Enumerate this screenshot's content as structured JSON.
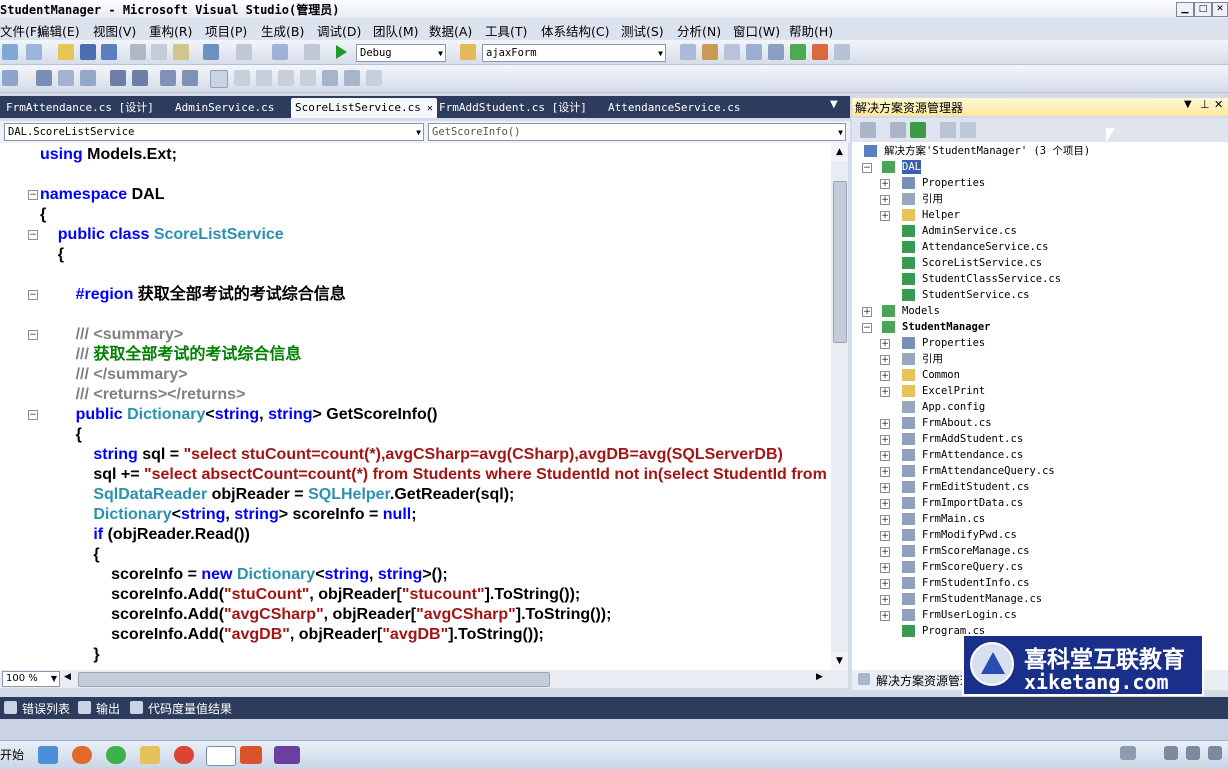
{
  "window": {
    "title": "StudentManager - Microsoft Visual Studio(管理员)"
  },
  "menu": [
    "文件(F)",
    "编辑(E)",
    "视图(V)",
    "重构(R)",
    "项目(P)",
    "生成(B)",
    "调试(D)",
    "团队(M)",
    "数据(A)",
    "工具(T)",
    "体系结构(C)",
    "测试(S)",
    "分析(N)",
    "窗口(W)",
    "帮助(H)"
  ],
  "toolbar": {
    "config": "Debug",
    "target": "ajaxForm"
  },
  "tabs": [
    {
      "label": "FrmAttendance.cs [设计]",
      "active": false
    },
    {
      "label": "AdminService.cs",
      "active": false
    },
    {
      "label": "ScoreListService.cs",
      "active": true
    },
    {
      "label": "FrmAddStudent.cs [设计]",
      "active": false
    },
    {
      "label": "AttendanceService.cs",
      "active": false
    }
  ],
  "navbar": {
    "type_combo": "DAL.ScoreListService",
    "member_combo": "GetScoreInfo()"
  },
  "code": [
    [
      {
        "t": "using ",
        "c": "kw"
      },
      {
        "t": "Models.Ext;",
        "c": ""
      }
    ],
    [],
    [
      {
        "t": "namespace ",
        "c": "kw"
      },
      {
        "t": "DAL",
        "c": ""
      }
    ],
    [
      {
        "t": "{",
        "c": ""
      }
    ],
    [
      {
        "t": "    public class ",
        "c": "kw"
      },
      {
        "t": "ScoreListService",
        "c": "ty"
      }
    ],
    [
      {
        "t": "    {",
        "c": ""
      }
    ],
    [],
    [
      {
        "t": "        #region ",
        "c": "kw"
      },
      {
        "t": "获取全部考试的考试综合信息",
        "c": ""
      }
    ],
    [],
    [
      {
        "t": "        /// ",
        "c": "gy"
      },
      {
        "t": "<summary>",
        "c": "gy"
      }
    ],
    [
      {
        "t": "        /// ",
        "c": "gy"
      },
      {
        "t": "获取全部考试的考试综合信息",
        "c": "cm"
      }
    ],
    [
      {
        "t": "        /// ",
        "c": "gy"
      },
      {
        "t": "</summary>",
        "c": "gy"
      }
    ],
    [
      {
        "t": "        /// ",
        "c": "gy"
      },
      {
        "t": "<returns></returns>",
        "c": "gy"
      }
    ],
    [
      {
        "t": "        public ",
        "c": "kw"
      },
      {
        "t": "Dictionary",
        "c": "ty"
      },
      {
        "t": "<",
        "c": ""
      },
      {
        "t": "string",
        "c": "kw"
      },
      {
        "t": ", ",
        "c": ""
      },
      {
        "t": "string",
        "c": "kw"
      },
      {
        "t": "> GetScoreInfo()",
        "c": ""
      }
    ],
    [
      {
        "t": "        {",
        "c": ""
      }
    ],
    [
      {
        "t": "            string ",
        "c": "kw"
      },
      {
        "t": "sql = ",
        "c": ""
      },
      {
        "t": "\"select stuCount=count(*),avgCSharp=avg(CSharp),avgDB=avg(SQLServerDB)",
        "c": "st"
      }
    ],
    [
      {
        "t": "            sql += ",
        "c": ""
      },
      {
        "t": "\"select absectCount=count(*) from Students where StudentId not in(select StudentId from ScoreList)\"",
        "c": "st"
      }
    ],
    [
      {
        "t": "            SqlDataReader ",
        "c": "ty"
      },
      {
        "t": "objReader = ",
        "c": ""
      },
      {
        "t": "SQLHelper",
        "c": "ty"
      },
      {
        "t": ".GetReader(sql);",
        "c": ""
      }
    ],
    [
      {
        "t": "            Dictionary",
        "c": "ty"
      },
      {
        "t": "<",
        "c": ""
      },
      {
        "t": "string",
        "c": "kw"
      },
      {
        "t": ", ",
        "c": ""
      },
      {
        "t": "string",
        "c": "kw"
      },
      {
        "t": "> scoreInfo = ",
        "c": ""
      },
      {
        "t": "null",
        "c": "kw"
      },
      {
        "t": ";",
        "c": ""
      }
    ],
    [
      {
        "t": "            if ",
        "c": "kw"
      },
      {
        "t": "(objReader.Read())",
        "c": ""
      }
    ],
    [
      {
        "t": "            {",
        "c": ""
      }
    ],
    [
      {
        "t": "                scoreInfo = ",
        "c": ""
      },
      {
        "t": "new ",
        "c": "kw"
      },
      {
        "t": "Dictionary",
        "c": "ty"
      },
      {
        "t": "<",
        "c": ""
      },
      {
        "t": "string",
        "c": "kw"
      },
      {
        "t": ", ",
        "c": ""
      },
      {
        "t": "string",
        "c": "kw"
      },
      {
        "t": ">();",
        "c": ""
      }
    ],
    [
      {
        "t": "                scoreInfo.Add(",
        "c": ""
      },
      {
        "t": "\"stuCount\"",
        "c": "st"
      },
      {
        "t": ", objReader[",
        "c": ""
      },
      {
        "t": "\"stucount\"",
        "c": "st"
      },
      {
        "t": "].ToString());",
        "c": ""
      }
    ],
    [
      {
        "t": "                scoreInfo.Add(",
        "c": ""
      },
      {
        "t": "\"avgCSharp\"",
        "c": "st"
      },
      {
        "t": ", objReader[",
        "c": ""
      },
      {
        "t": "\"avgCSharp\"",
        "c": "st"
      },
      {
        "t": "].ToString());",
        "c": ""
      }
    ],
    [
      {
        "t": "                scoreInfo.Add(",
        "c": ""
      },
      {
        "t": "\"avgDB\"",
        "c": "st"
      },
      {
        "t": ", objReader[",
        "c": ""
      },
      {
        "t": "\"avgDB\"",
        "c": "st"
      },
      {
        "t": "].ToString());",
        "c": ""
      }
    ],
    [
      {
        "t": "            }",
        "c": ""
      }
    ]
  ],
  "zoom": "100 %",
  "solution_explorer": {
    "title": "解决方案资源管理器",
    "tab_label": "解决方案资源管理器",
    "nodes": [
      {
        "label": "解决方案'StudentManager' (3 个项目)",
        "level": 0,
        "exp": "",
        "icon": "solution"
      },
      {
        "label": "DAL",
        "level": 1,
        "exp": "−",
        "icon": "project",
        "selected": true
      },
      {
        "label": "Properties",
        "level": 2,
        "exp": "+",
        "icon": "properties"
      },
      {
        "label": "引用",
        "level": 2,
        "exp": "+",
        "icon": "references"
      },
      {
        "label": "Helper",
        "level": 2,
        "exp": "+",
        "icon": "folder"
      },
      {
        "label": "AdminService.cs",
        "level": 2,
        "exp": "",
        "icon": "cs"
      },
      {
        "label": "AttendanceService.cs",
        "level": 2,
        "exp": "",
        "icon": "cs"
      },
      {
        "label": "ScoreListService.cs",
        "level": 2,
        "exp": "",
        "icon": "cs"
      },
      {
        "label": "StudentClassService.cs",
        "level": 2,
        "exp": "",
        "icon": "cs"
      },
      {
        "label": "StudentService.cs",
        "level": 2,
        "exp": "",
        "icon": "cs"
      },
      {
        "label": "Models",
        "level": 1,
        "exp": "+",
        "icon": "project"
      },
      {
        "label": "StudentManager",
        "level": 1,
        "exp": "−",
        "icon": "project",
        "bold": true
      },
      {
        "label": "Properties",
        "level": 2,
        "exp": "+",
        "icon": "properties"
      },
      {
        "label": "引用",
        "level": 2,
        "exp": "+",
        "icon": "references"
      },
      {
        "label": "Common",
        "level": 2,
        "exp": "+",
        "icon": "folder"
      },
      {
        "label": "ExcelPrint",
        "level": 2,
        "exp": "+",
        "icon": "folder"
      },
      {
        "label": "App.config",
        "level": 2,
        "exp": "",
        "icon": "config"
      },
      {
        "label": "FrmAbout.cs",
        "level": 2,
        "exp": "+",
        "icon": "form"
      },
      {
        "label": "FrmAddStudent.cs",
        "level": 2,
        "exp": "+",
        "icon": "form"
      },
      {
        "label": "FrmAttendance.cs",
        "level": 2,
        "exp": "+",
        "icon": "form"
      },
      {
        "label": "FrmAttendanceQuery.cs",
        "level": 2,
        "exp": "+",
        "icon": "form"
      },
      {
        "label": "FrmEditStudent.cs",
        "level": 2,
        "exp": "+",
        "icon": "form"
      },
      {
        "label": "FrmImportData.cs",
        "level": 2,
        "exp": "+",
        "icon": "form"
      },
      {
        "label": "FrmMain.cs",
        "level": 2,
        "exp": "+",
        "icon": "form"
      },
      {
        "label": "FrmModifyPwd.cs",
        "level": 2,
        "exp": "+",
        "icon": "form"
      },
      {
        "label": "FrmScoreManage.cs",
        "level": 2,
        "exp": "+",
        "icon": "form"
      },
      {
        "label": "FrmScoreQuery.cs",
        "level": 2,
        "exp": "+",
        "icon": "form"
      },
      {
        "label": "FrmStudentInfo.cs",
        "level": 2,
        "exp": "+",
        "icon": "form"
      },
      {
        "label": "FrmStudentManage.cs",
        "level": 2,
        "exp": "+",
        "icon": "form"
      },
      {
        "label": "FrmUserLogin.cs",
        "level": 2,
        "exp": "+",
        "icon": "form"
      },
      {
        "label": "Program.cs",
        "level": 2,
        "exp": "",
        "icon": "cs"
      }
    ]
  },
  "bottom_tabs": [
    "错误列表",
    "输出",
    "代码度量值结果"
  ],
  "taskbar": {
    "start": "开始"
  },
  "watermark": {
    "cn": "喜科堂互联教育",
    "en": "xiketang.com"
  },
  "colors": {
    "keyword": "#0000ff",
    "type": "#2b91af",
    "string": "#a31515",
    "comment": "#008000",
    "tab_strip": "#2d3c5c"
  }
}
